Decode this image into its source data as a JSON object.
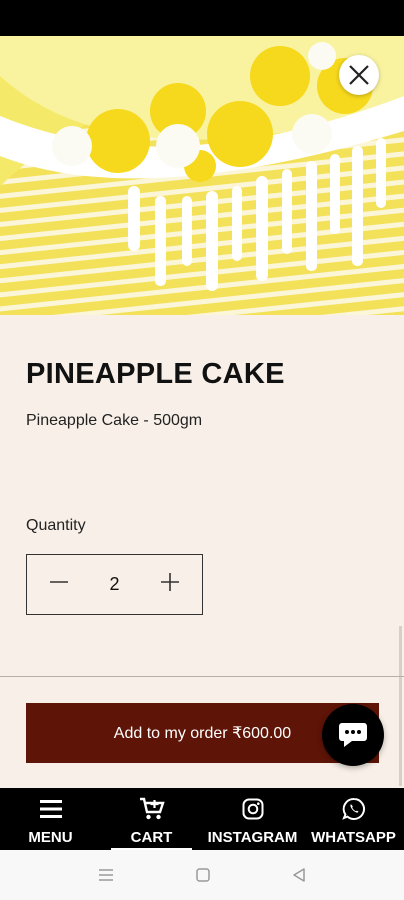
{
  "product": {
    "title": "PINEAPPLE CAKE",
    "subtitle": "Pineapple Cake - 500gm",
    "image_icon": "cake-photo"
  },
  "quantity": {
    "label": "Quantity",
    "value": "2"
  },
  "order_button": {
    "label": "Add to my order ₹600.00"
  },
  "bottom_nav": [
    {
      "label": "MENU",
      "icon": "menu-icon"
    },
    {
      "label": "CART",
      "icon": "cart-icon",
      "active": true
    },
    {
      "label": "INSTAGRAM",
      "icon": "instagram-icon"
    },
    {
      "label": "WHATSAPP",
      "icon": "whatsapp-icon"
    }
  ],
  "colors": {
    "background": "#f8f0e8",
    "button": "#5e1407",
    "nav": "#000000"
  }
}
